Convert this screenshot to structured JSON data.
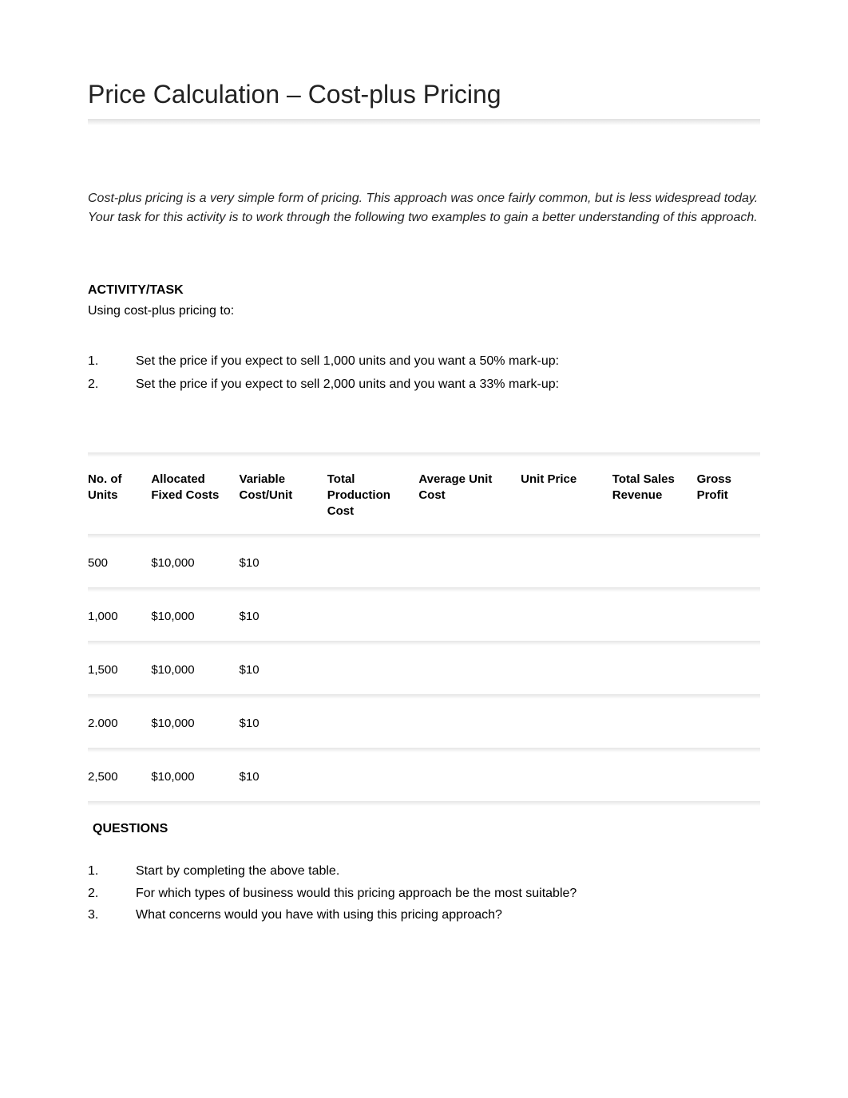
{
  "title": "Price Calculation – Cost-plus Pricing",
  "intro": "Cost-plus pricing is a very simple form of pricing. This approach was once fairly common, but is less widespread today. Your task for this activity is to work through the following two examples to gain a better understanding of this approach.",
  "activity": {
    "heading": "ACTIVITY/TASK",
    "sub": "Using cost-plus pricing to:",
    "items": [
      {
        "num": "1.",
        "text": "Set the price if you expect to sell 1,000 units and you want a 50% mark-up:"
      },
      {
        "num": "2.",
        "text": "Set the price if you expect to sell 2,000 units and you want a 33% mark-up:"
      }
    ]
  },
  "table": {
    "headers": {
      "units": "No. of Units",
      "fixed": "Allocated Fixed Costs",
      "var": "Variable Cost/Unit",
      "total": "Total Production Cost",
      "avg": "Average Unit Cost",
      "price": "Unit Price",
      "rev": "Total Sales Revenue",
      "profit": "Gross Profit"
    },
    "rows": [
      {
        "units": "500",
        "fixed": "$10,000",
        "var": "$10",
        "total": "",
        "avg": "",
        "price": "",
        "rev": "",
        "profit": ""
      },
      {
        "units": "1,000",
        "fixed": "$10,000",
        "var": "$10",
        "total": "",
        "avg": "",
        "price": "",
        "rev": "",
        "profit": ""
      },
      {
        "units": "1,500",
        "fixed": "$10,000",
        "var": "$10",
        "total": "",
        "avg": "",
        "price": "",
        "rev": "",
        "profit": ""
      },
      {
        "units": "2.000",
        "fixed": "$10,000",
        "var": "$10",
        "total": "",
        "avg": "",
        "price": "",
        "rev": "",
        "profit": ""
      },
      {
        "units": "2,500",
        "fixed": "$10,000",
        "var": "$10",
        "total": "",
        "avg": "",
        "price": "",
        "rev": "",
        "profit": ""
      }
    ]
  },
  "questions": {
    "heading": "QUESTIONS",
    "items": [
      {
        "num": "1.",
        "text": "Start by completing the above table."
      },
      {
        "num": "2.",
        "text": "For which types of business would this pricing approach be the most suitable?"
      },
      {
        "num": "3.",
        "text": "What concerns would you have with using this pricing approach?"
      }
    ]
  }
}
